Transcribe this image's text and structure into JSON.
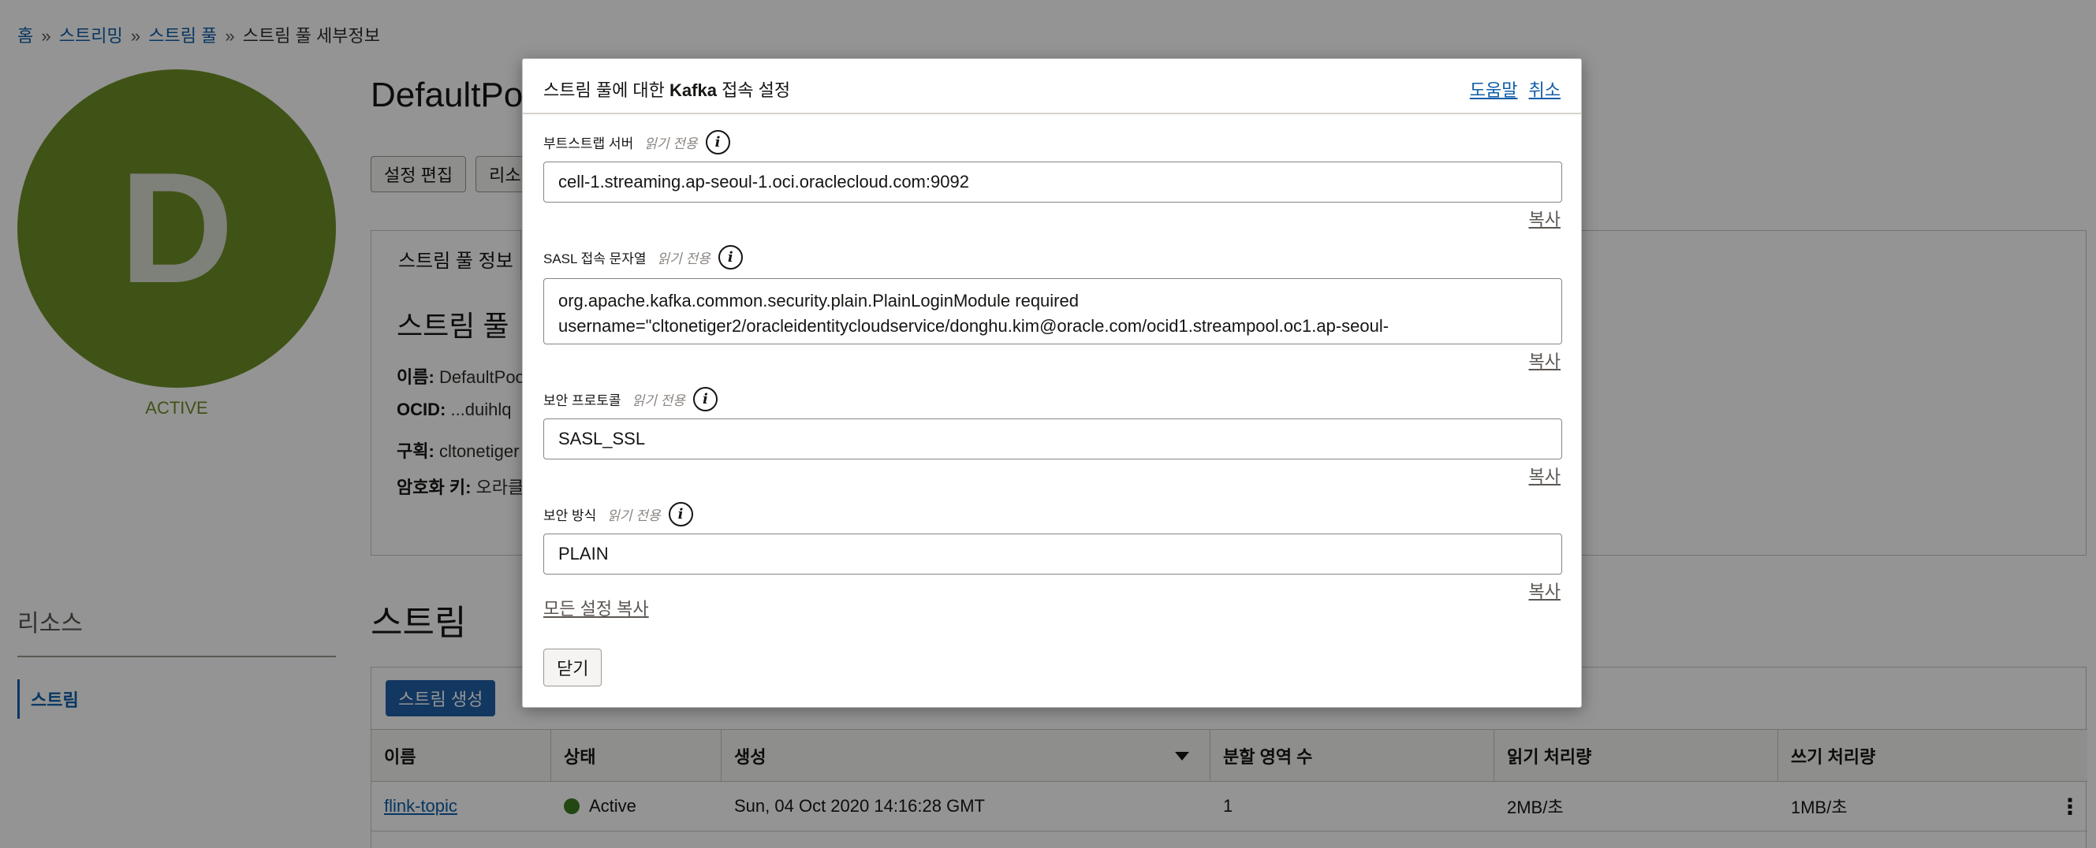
{
  "breadcrumb": {
    "home": "홈",
    "streaming": "스트리밍",
    "stream_pools": "스트림 풀",
    "current": "스트림 풀 세부정보",
    "separator": "»"
  },
  "pool": {
    "avatar_letter": "D",
    "status": "ACTIVE",
    "title": "DefaultPo"
  },
  "toolbar": {
    "edit_settings": "설정 편집",
    "resources_btn": "리소"
  },
  "info": {
    "tab": "스트림 풀 정보",
    "heading": "스트림 풀 ",
    "name_label": "이름:",
    "name_value": "DefaultPoo",
    "ocid_label": "OCID:",
    "ocid_value": "...duihlq",
    "compartment_label": "구획:",
    "compartment_value": "cltonetiger",
    "encryption_label": "암호화 키:",
    "encryption_value": "오라클"
  },
  "resources": {
    "title": "리소스",
    "item": "스트림"
  },
  "streams": {
    "title": "스트림",
    "create_button": "스트림 생성",
    "columns": [
      "이름",
      "상태",
      "생성",
      "분할 영역 수",
      "읽기 처리량",
      "쓰기 처리량"
    ],
    "rows": [
      {
        "name": "flink-topic",
        "status": "Active",
        "created": "Sun, 04 Oct 2020 14:16:28 GMT",
        "partitions": "1",
        "read": "2MB/초",
        "write": "1MB/초"
      }
    ]
  },
  "dialog": {
    "title_prefix": "스트림 풀에 대한 ",
    "title_bold": "Kafka",
    "title_suffix": " 접속 설정",
    "help": "도움말",
    "cancel": "취소",
    "readonly_text": "읽기 전용",
    "info_glyph": "i",
    "copy_label": "복사",
    "copy_all": "모든 설정 복사",
    "close": "닫기",
    "fields": {
      "bootstrap": {
        "label": "부트스트랩 서버",
        "value": "cell-1.streaming.ap-seoul-1.oci.oraclecloud.com:9092"
      },
      "sasl": {
        "label": "SASL 접속 문자열",
        "line1": "org.apache.kafka.common.security.plain.PlainLoginModule required",
        "line2": "username=\"cltonetiger2/oracleidentitycloudservice/donghu.kim@oracle.com/ocid1.streampool.oc1.ap-seoul-"
      },
      "protocol": {
        "label": "보안 프로토콜",
        "value": "SASL_SSL"
      },
      "mechanism": {
        "label": "보안 방식",
        "value": "PLAIN"
      }
    }
  }
}
